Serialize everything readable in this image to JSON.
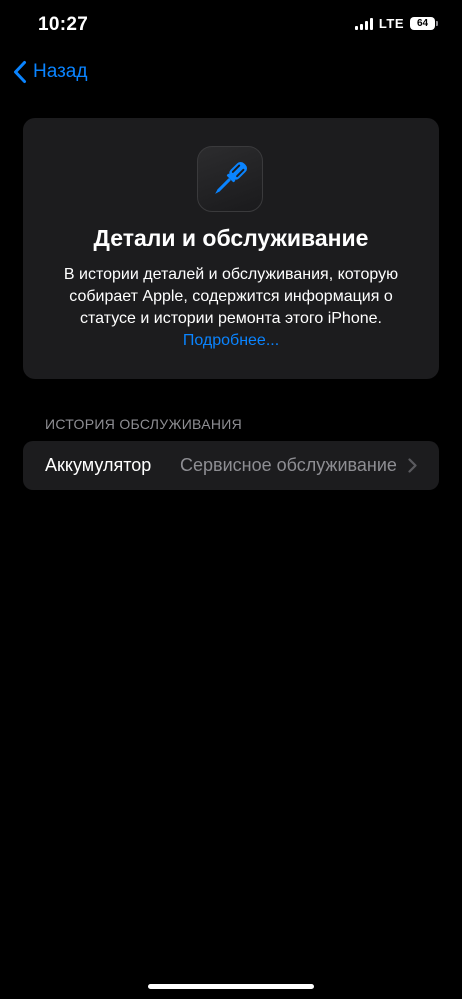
{
  "status_bar": {
    "time": "10:27",
    "network": "LTE",
    "battery": "64"
  },
  "nav": {
    "back_label": "Назад"
  },
  "info_card": {
    "icon": "screwdriver-icon",
    "title": "Детали и обслуживание",
    "description": "В истории деталей и обслуживания, которую собирает Apple, содержится информация о статусе и истории ремонта этого iPhone.",
    "link_label": "Подробнее..."
  },
  "service_history": {
    "header": "ИСТОРИЯ ОБСЛУЖИВАНИЯ",
    "items": [
      {
        "label": "Аккумулятор",
        "value": "Сервисное обслуживание"
      }
    ]
  },
  "colors": {
    "background": "#000000",
    "card": "#1c1c1e",
    "accent": "#0a84ff",
    "secondary_text": "#8e8e93"
  }
}
